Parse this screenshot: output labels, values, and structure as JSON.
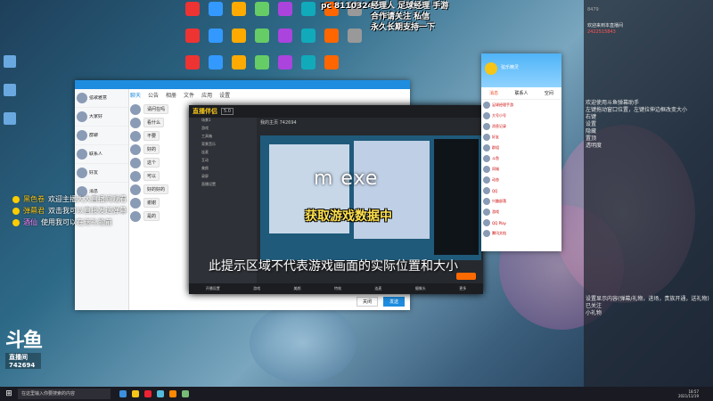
{
  "stream_overlay": {
    "line1": "游戏：",
    "line2": "经理人 足球经理 手游",
    "line3": "合作请关注 私信",
    "line4": "永久长期支持一下"
  },
  "desktop": {
    "icons": [
      "",
      "",
      "",
      "",
      "",
      "",
      "",
      "",
      "",
      "",
      "",
      "",
      "",
      "",
      "",
      "",
      "",
      "",
      "",
      "",
      "",
      "",
      ""
    ],
    "pc_label": "pc 8110324"
  },
  "qq_chat": {
    "tabs": [
      "聊天",
      "公告",
      "相册",
      "文件",
      "应用",
      "设置"
    ],
    "list": [
      {
        "name": "弦歌雅意",
        "preview": ""
      },
      {
        "name": "大家好",
        "preview": ""
      },
      {
        "name": "群聊",
        "preview": ""
      },
      {
        "name": "联系人",
        "preview": ""
      },
      {
        "name": "好友",
        "preview": ""
      },
      {
        "name": "消息",
        "preview": ""
      }
    ],
    "messages": [
      "请问在吗",
      "看什么",
      "不要",
      "好的",
      "这个",
      "可以",
      "好的好的",
      "谢谢",
      "是的"
    ],
    "close_label": "关闭",
    "send_label": "发送"
  },
  "obs": {
    "title": "直播伴侣",
    "tag": "5.0",
    "preview_header": "我的主页 742694",
    "side_rows": [
      "场景1",
      "游戏",
      "工具箱",
      "背景音乐",
      "连麦",
      "互动",
      "美颜",
      "录屏",
      "直播设置"
    ],
    "bottom": [
      "开播设置",
      "游戏",
      "美颜",
      "特效",
      "连麦",
      "摄像头",
      "更多"
    ],
    "start_button": "开始直播"
  },
  "overlay_text": {
    "exe": "m exe",
    "yellow": "获取游戏数据中",
    "caption": "此提示区域不代表游戏画面的实际位置和大小"
  },
  "qq_main": {
    "name": "弦乐精灵",
    "tabs": [
      "消息",
      "联系人",
      "空间"
    ],
    "rows": [
      "足球经理手游",
      "大号小号",
      "消息记录",
      "好友",
      "群组",
      "斗鱼",
      "同城",
      "动态",
      "QQ",
      "兴趣部落",
      "游戏",
      "QQ Play",
      "腾讯文档"
    ]
  },
  "danmu": [
    {
      "name": "黑色卷",
      "text": "欢迎主播大大直播间观看"
    },
    {
      "name": "弹幕君",
      "text": "双击我可以直接发送弹幕"
    },
    {
      "name": "酒仙",
      "text": "使用我可以在送礼物前"
    }
  ],
  "panel": {
    "header": "8479",
    "lines": [
      "欢迎来到本直播间",
      "2422515843"
    ],
    "block1": [
      "欢迎使用斗鱼弹幕助手",
      "左键拖动窗口位置，左键拉伸边框改变大小",
      "右键",
      "设置",
      "隐藏",
      "置顶",
      "透明度"
    ],
    "block2": [
      "设置显示内容(弹幕/礼物，进场，贵族开通，送礼物)",
      "已关注",
      "小礼物"
    ]
  },
  "logo": {
    "big": "斗鱼",
    "small": "直播间",
    "room": "742694"
  },
  "taskbar": {
    "search": "在这里输入你要搜索的内容",
    "time": "18:57",
    "date": "2021/11/19"
  }
}
